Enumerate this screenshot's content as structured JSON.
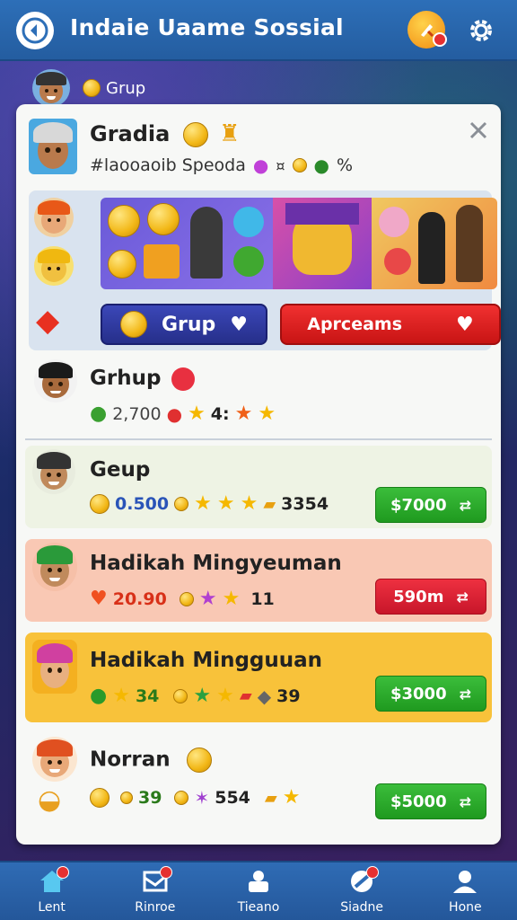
{
  "header": {
    "title": "Indaie Uaame Sossial",
    "back_icon": "back-arrow-icon",
    "badge_icon": "rocket-badge-icon",
    "settings_icon": "gear-icon"
  },
  "group_tag": {
    "label": "Grup"
  },
  "profile": {
    "name": "Gradia",
    "subtitle": "#laooaoib  Speoda",
    "count": "%"
  },
  "banner": {
    "grup_button": "Grup",
    "apr_button": "Aprceams"
  },
  "featured": {
    "name": "Grhup",
    "value": "2,700",
    "extra": "4:"
  },
  "rows": [
    {
      "name": "Geup",
      "value": "0.500",
      "extra": "3354",
      "price": "$7000",
      "bg": "#eef3e4",
      "value_color": "#2a54b8",
      "button": "green"
    },
    {
      "name": "Hadikah Mingyeuman",
      "value": "20.90",
      "extra": "11",
      "price": "590m",
      "bg": "#f9c8b4",
      "value_color": "#d83018",
      "button": "red"
    },
    {
      "name": "Hadikah Mingguuan",
      "value": "34",
      "extra": "39",
      "price": "$3000",
      "bg": "#f8c23a",
      "value_color": "#2a7a1a",
      "button": "green"
    },
    {
      "name": "Norran",
      "value": "39",
      "extra": "554",
      "price": "$5000",
      "bg": "#f7f8f6",
      "value_color": "#2a7a1a",
      "button": "green"
    }
  ],
  "nav": [
    {
      "label": "Lent",
      "icon": "home-icon",
      "dot": true
    },
    {
      "label": "Rinroe",
      "icon": "map-icon",
      "dot": true
    },
    {
      "label": "Tieano",
      "icon": "bag-icon",
      "dot": false
    },
    {
      "label": "Siadne",
      "icon": "tag-icon",
      "dot": true
    },
    {
      "label": "Hone",
      "icon": "profile-icon",
      "dot": false
    }
  ],
  "colors": {
    "header": "#2d6fb8",
    "green_button": "#1f9a1f",
    "red_button": "#c8162a",
    "grup_button": "#262f8a"
  }
}
